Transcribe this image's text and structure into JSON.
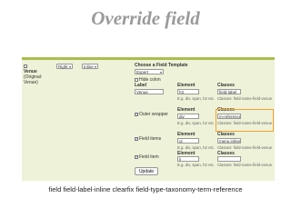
{
  "slide": {
    "title": "Override field",
    "caption": "field field-label-inline clearfix field-type-taxonomy-term-reference"
  },
  "ui": {
    "row_label": "Venue",
    "row_sub1": "(Original:",
    "row_sub2": "Venue)",
    "label_position": "Right",
    "display_format": "Inline",
    "template_heading": "Choose a Field Template",
    "template_value": "Expert",
    "hide_colon": "Hide colon",
    "col_label": "Label",
    "col_element": "Element",
    "col_classes": "Classes",
    "label_value": "Venue",
    "label_element": "h3",
    "label_classes": "field-label",
    "label_hint_element": "E.g. div, span, h2 etc.",
    "label_hint_classes": "Classes: field-name-field-venue",
    "outer_wrapper": "Outer wrapper",
    "outer_element": "div",
    "outer_classes": "m-reference",
    "outer_hint_element": "E.g. div, span, h2 etc.",
    "outer_hint_classes": "Classes: field-name-field-venue",
    "field_items": "Field items",
    "items_element": "ul",
    "items_classes": "menu inline",
    "items_hint_element": "E.g. div, span, h2 etc.",
    "items_hint_classes": "Classes: field-name-field-venue",
    "field_item": "Field item",
    "item_element": "li",
    "item_hint_element": "E.g. div, span, h2 etc.",
    "item_hint_classes": "Classes: field-name-field-venue",
    "update_label": "Update"
  }
}
